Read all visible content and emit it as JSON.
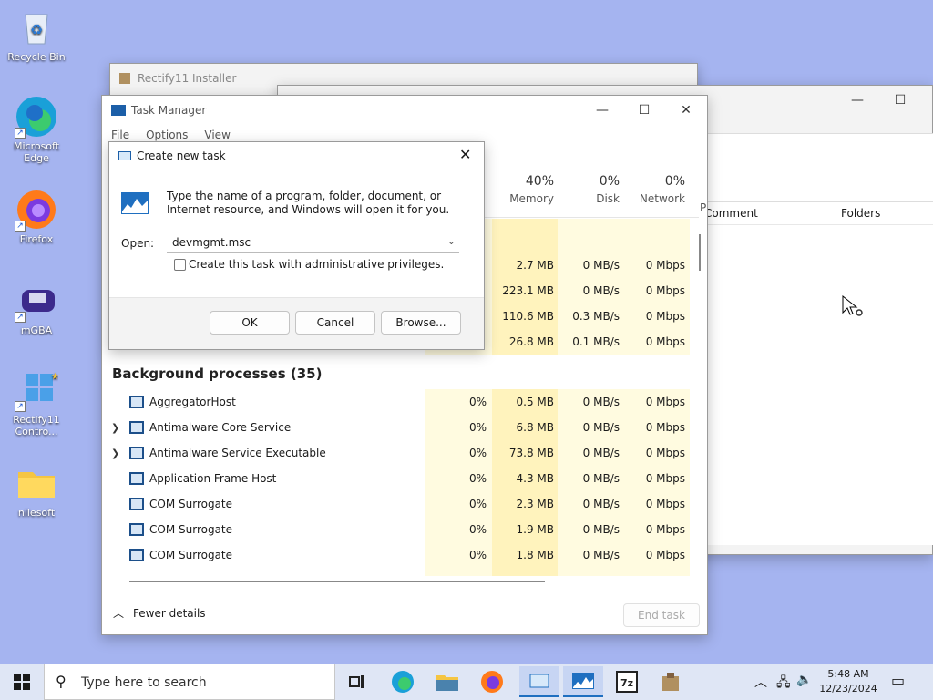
{
  "desktop": {
    "icons": [
      {
        "label": "Recycle Bin"
      },
      {
        "label": "Microsoft Edge"
      },
      {
        "label": "Firefox"
      },
      {
        "label": "mGBA"
      },
      {
        "label": "Rectify11 Contro..."
      },
      {
        "label": "nilesoft"
      }
    ]
  },
  "installer": {
    "title": "Rectify11 Installer"
  },
  "explorer": {
    "col_comment": "Comment",
    "col_folders": "Folders"
  },
  "taskmgr": {
    "title": "Task Manager",
    "menu": [
      "File",
      "Options",
      "View"
    ],
    "columns": {
      "memory_pct": "40%",
      "memory_label": "Memory",
      "disk_pct": "0%",
      "disk_label": "Disk",
      "network_pct": "0%",
      "network_label": "Network"
    },
    "apps_rows": [
      {
        "memory": "2.7 MB",
        "disk": "0 MB/s",
        "network": "0 Mbps"
      },
      {
        "memory": "223.1 MB",
        "disk": "0 MB/s",
        "network": "0 Mbps"
      },
      {
        "memory": "110.6 MB",
        "disk": "0.3 MB/s",
        "network": "0 Mbps"
      },
      {
        "memory": "26.8 MB",
        "disk": "0.1 MB/s",
        "network": "0 Mbps"
      }
    ],
    "bg_header": "Background processes (35)",
    "bg_rows": [
      {
        "name": "AggregatorHost",
        "cpu": "0%",
        "memory": "0.5 MB",
        "disk": "0 MB/s",
        "network": "0 Mbps",
        "expandable": false
      },
      {
        "name": "Antimalware Core Service",
        "cpu": "0%",
        "memory": "6.8 MB",
        "disk": "0 MB/s",
        "network": "0 Mbps",
        "expandable": true
      },
      {
        "name": "Antimalware Service Executable",
        "cpu": "0%",
        "memory": "73.8 MB",
        "disk": "0 MB/s",
        "network": "0 Mbps",
        "expandable": true
      },
      {
        "name": "Application Frame Host",
        "cpu": "0%",
        "memory": "4.3 MB",
        "disk": "0 MB/s",
        "network": "0 Mbps",
        "expandable": false
      },
      {
        "name": "COM Surrogate",
        "cpu": "0%",
        "memory": "2.3 MB",
        "disk": "0 MB/s",
        "network": "0 Mbps",
        "expandable": false
      },
      {
        "name": "COM Surrogate",
        "cpu": "0%",
        "memory": "1.9 MB",
        "disk": "0 MB/s",
        "network": "0 Mbps",
        "expandable": false
      },
      {
        "name": "COM Surrogate",
        "cpu": "0%",
        "memory": "1.8 MB",
        "disk": "0 MB/s",
        "network": "0 Mbps",
        "expandable": false
      }
    ],
    "fewer_details": "Fewer details",
    "end_task": "End task"
  },
  "dialog": {
    "title": "Create new task",
    "description": "Type the name of a program, folder, document, or Internet resource, and Windows will open it for you.",
    "open_label": "Open:",
    "open_value": "devmgmt.msc",
    "admin_label": "Create this task with administrative privileges.",
    "ok": "OK",
    "cancel": "Cancel",
    "browse": "Browse..."
  },
  "taskbar": {
    "search_placeholder": "Type here to search",
    "time": "5:48 AM",
    "date": "12/23/2024"
  },
  "colors": {
    "desktop": "#a5b4f0",
    "heat_light": "#fff9d6",
    "heat_mid": "#fff1b0"
  }
}
